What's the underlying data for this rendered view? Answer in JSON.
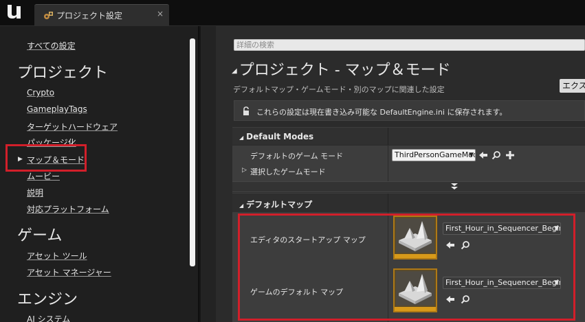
{
  "tab": {
    "label": "プロジェクト設定",
    "close": "×"
  },
  "nav": {
    "all_settings": "すべての設定",
    "project_category": "プロジェクト",
    "project_items": [
      "Crypto",
      "GameplayTags",
      "ターゲットハードウェア",
      "パッケージ化",
      "マップ＆モード",
      "ムービー",
      "説明",
      "対応プラットフォーム"
    ],
    "selected_arrow": "▶",
    "game_category": "ゲーム",
    "game_items": [
      "アセット ツール",
      "アセット マネージャー"
    ],
    "engine_category": "エンジン",
    "engine_items": [
      "AI システム"
    ]
  },
  "search": {
    "placeholder": "詳細の検索"
  },
  "main": {
    "title": "プロジェクト - マップ＆モード",
    "title_arrow": "◢",
    "description": "デフォルトマップ・ゲームモード・別のマップに関連した設定",
    "export_button": "エクスポート",
    "notice": "これらの設定は現在書き込み可能な DefaultEngine.ini に保存されます。"
  },
  "default_modes": {
    "header": "Default Modes",
    "header_arrow": "◢",
    "default_gamemode_label": "デフォルトのゲーム モード",
    "default_gamemode_value": "ThirdPersonGameMode",
    "selected_gamemode_label": "選択したゲームモード",
    "selected_gamemode_arrow": "▷"
  },
  "default_maps": {
    "header": "デフォルトマップ",
    "header_arrow": "◢",
    "editor_startup_label": "エディタのスタートアップ マップ",
    "editor_startup_value": "First_Hour_in_Sequencer_Begin",
    "game_default_label": "ゲームのデフォルト マップ",
    "game_default_value": "First_Hour_in_Sequencer_Begin"
  },
  "colors": {
    "highlight": "#d21f2a",
    "panel": "#3d3d3d",
    "thumb_accent": "#d89a1a"
  },
  "icons": [
    "ue-logo-icon",
    "project-settings-icon",
    "lock-icon",
    "use-selected-arrow-icon",
    "browse-magnifier-icon",
    "add-plus-icon",
    "dropdown-arrow-icon",
    "expand-more-icon"
  ]
}
